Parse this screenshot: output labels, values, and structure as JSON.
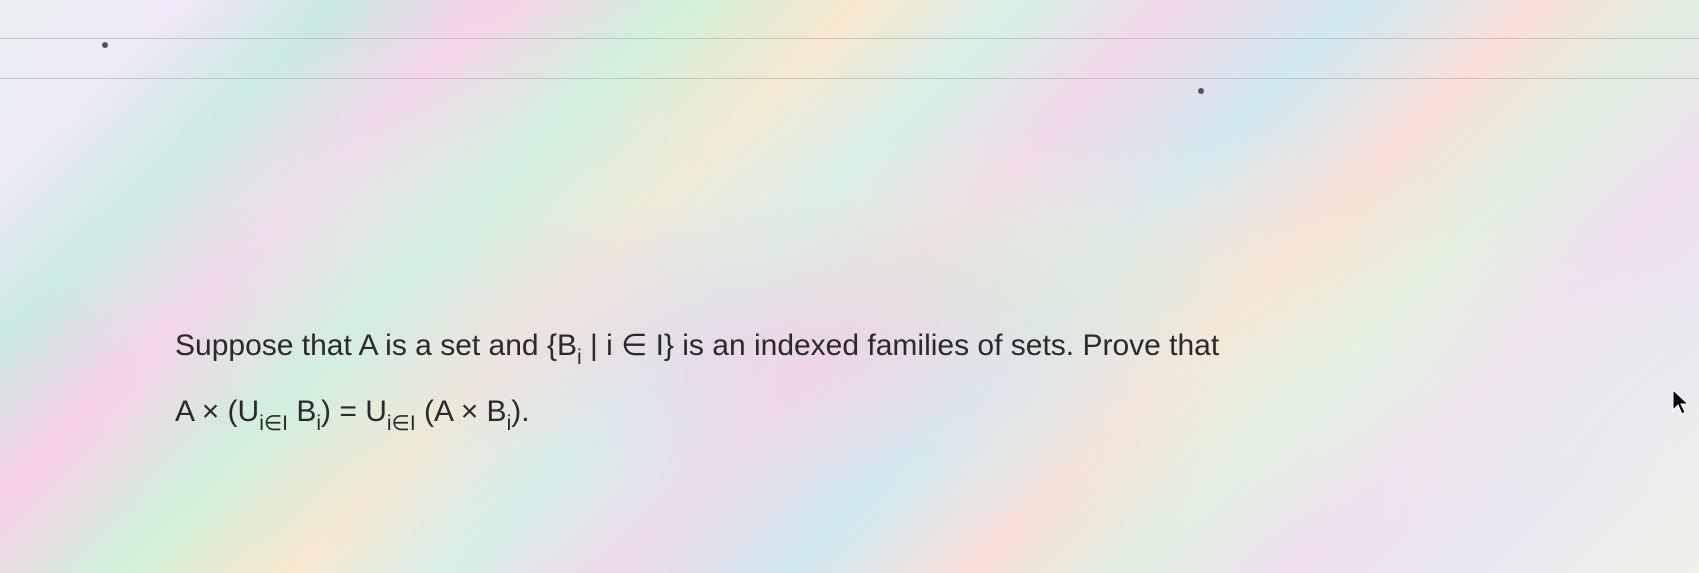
{
  "problem": {
    "line1_prefix": "Suppose that A is a set and {B",
    "line1_sub1": "i",
    "line1_mid": " | i ∈ I} is an indexed families of sets. Prove that",
    "line2_part1": "A × (U",
    "line2_sub1": "i∈I",
    "line2_part2": " B",
    "line2_sub2": "i",
    "line2_part3": ") = U",
    "line2_sub3": "i∈I",
    "line2_part4": " (A × B",
    "line2_sub4": "i",
    "line2_part5": ")."
  }
}
